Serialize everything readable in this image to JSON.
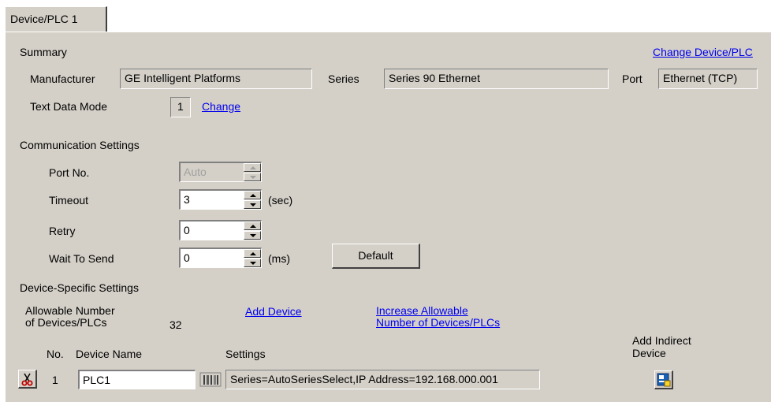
{
  "tab": {
    "label": "Device/PLC 1"
  },
  "summary": {
    "heading": "Summary",
    "change_link": "Change Device/PLC",
    "manufacturer_label": "Manufacturer",
    "manufacturer_value": "GE Intelligent Platforms",
    "series_label": "Series",
    "series_value": "Series 90 Ethernet",
    "port_label": "Port",
    "port_value": "Ethernet (TCP)",
    "text_mode_label": "Text Data Mode",
    "text_mode_value": "1",
    "text_mode_change": "Change"
  },
  "comm": {
    "heading": "Communication Settings",
    "port_no_label": "Port No.",
    "port_no_value": "Auto",
    "timeout_label": "Timeout",
    "timeout_value": "3",
    "timeout_unit": "(sec)",
    "retry_label": "Retry",
    "retry_value": "0",
    "wait_label": "Wait To Send",
    "wait_value": "0",
    "wait_unit": "(ms)",
    "default_button": "Default"
  },
  "device": {
    "heading": "Device-Specific Settings",
    "allowable_label_1": "Allowable Number",
    "allowable_label_2": "of Devices/PLCs",
    "allowable_value": "32",
    "add_device": "Add Device",
    "increase_1": "Increase Allowable",
    "increase_2": "Number of Devices/PLCs",
    "col_no": "No.",
    "col_name": "Device Name",
    "col_settings": "Settings",
    "col_indirect_1": "Add Indirect",
    "col_indirect_2": "Device",
    "rows": [
      {
        "no": "1",
        "name": "PLC1",
        "settings": "Series=AutoSeriesSelect,IP Address=192.168.000.001"
      }
    ]
  }
}
